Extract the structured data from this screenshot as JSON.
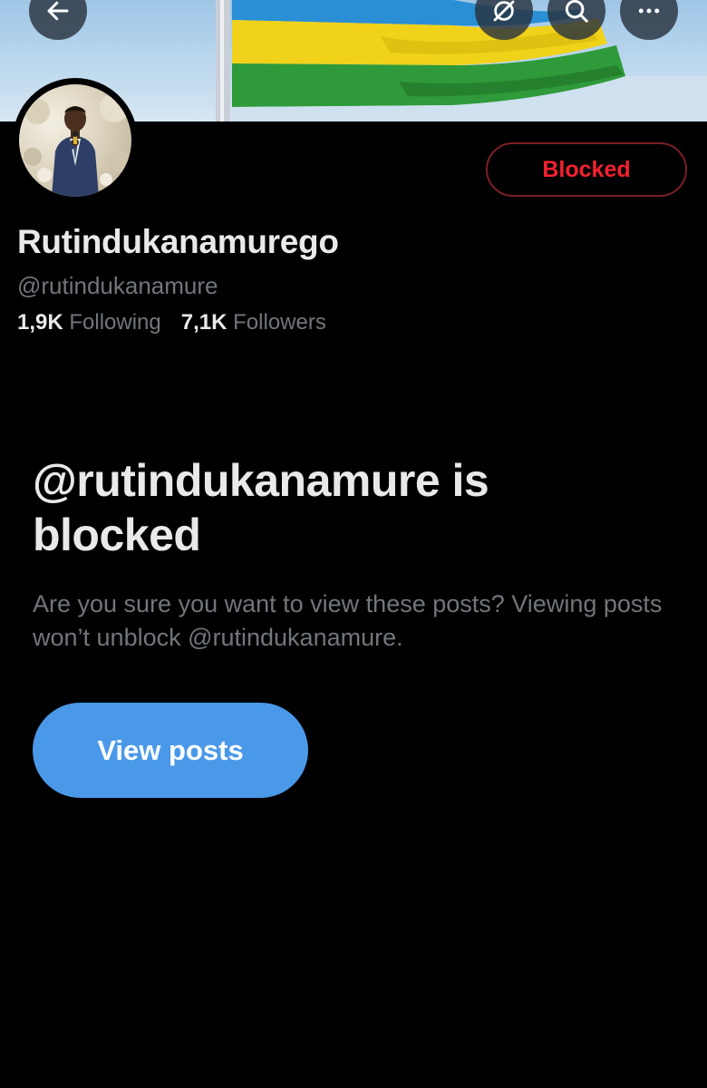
{
  "header": {
    "back_icon": "arrow-left-icon",
    "grok_icon": "grok-icon",
    "search_icon": "search-icon",
    "more_icon": "more-horizontal-icon"
  },
  "profile": {
    "display_name": "Rutindukanamurego",
    "handle": "@rutindukanamure",
    "following_count": "1,9K",
    "following_label": "Following",
    "followers_count": "7,1K",
    "followers_label": "Followers",
    "blocked_button_label": "Blocked"
  },
  "blocked_notice": {
    "title": "@rutindukanamure is blocked",
    "description": "Are you sure you want to view these posts? Viewing posts won’t unblock @rutindukanamure.",
    "view_posts_label": "View posts"
  },
  "colors": {
    "background": "#000000",
    "blocked_red": "#f4212e",
    "primary_blue": "#4a99e9",
    "secondary_text": "#71767b"
  }
}
